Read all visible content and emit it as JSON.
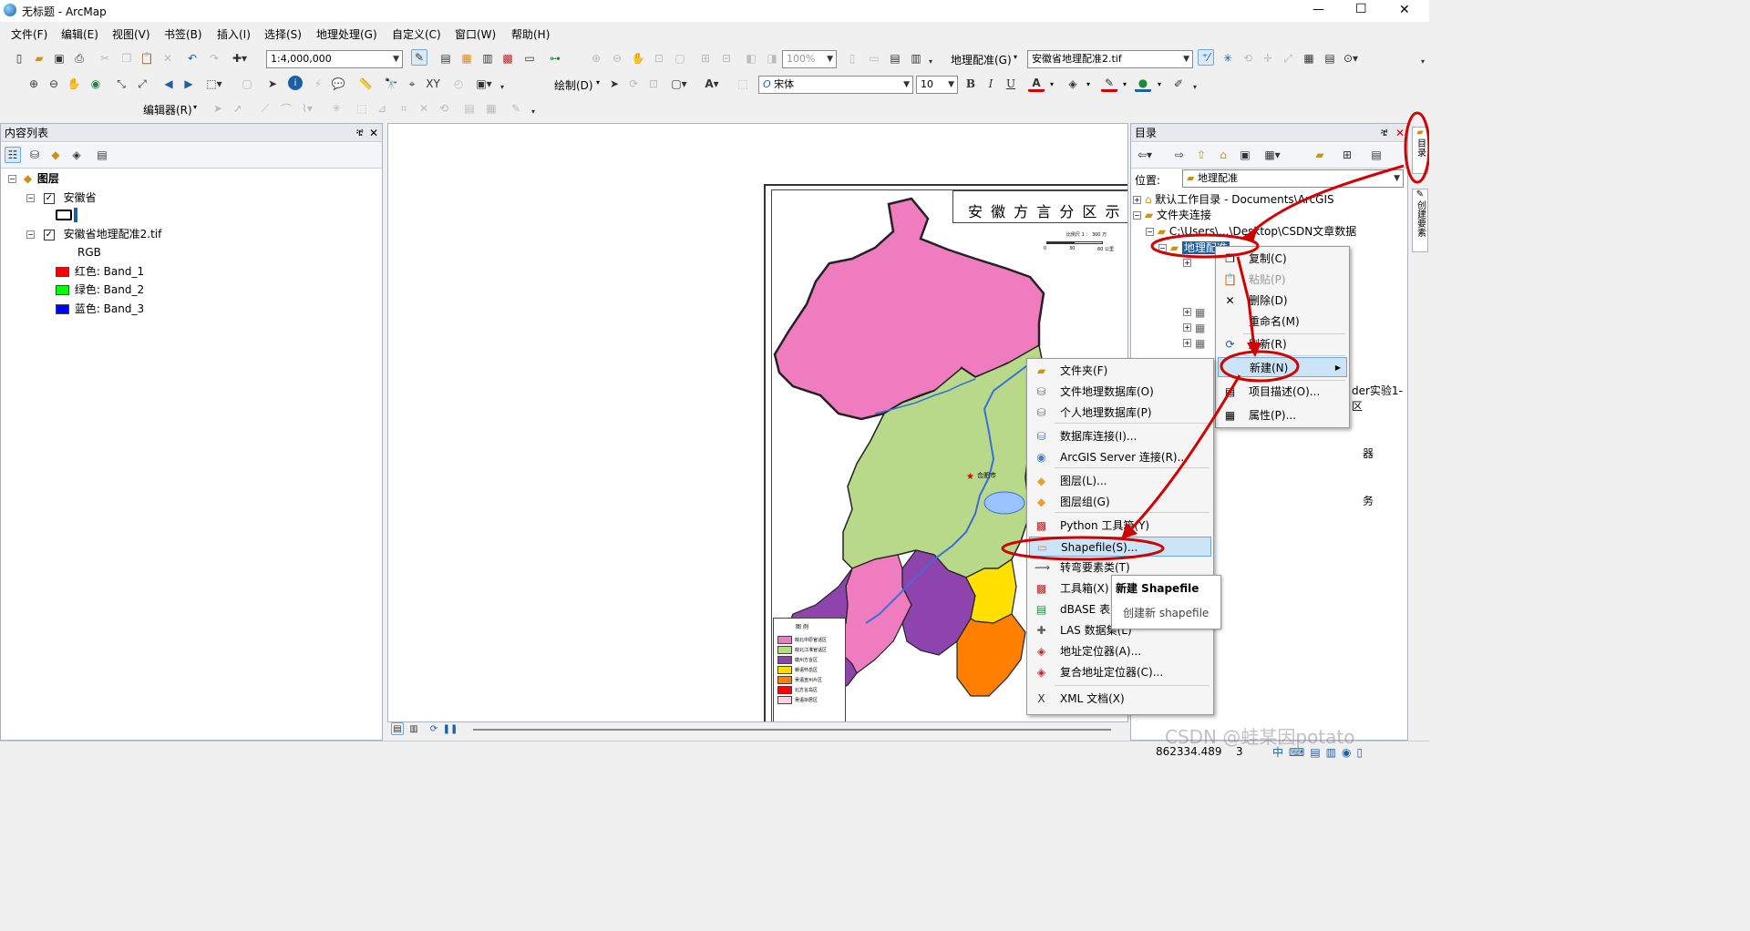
{
  "window": {
    "title": "无标题 - ArcMap",
    "controls": [
      "—",
      "☐",
      "✕"
    ]
  },
  "menubar": [
    "文件(F)",
    "编辑(E)",
    "视图(V)",
    "书签(B)",
    "插入(I)",
    "选择(S)",
    "地理处理(G)",
    "自定义(C)",
    "窗口(W)",
    "帮助(H)"
  ],
  "toolbar": {
    "scale": "1:4,000,000",
    "zoom": "100%",
    "georef_label": "地理配准(G)",
    "georef_layer": "安徽省地理配准2.tif",
    "draw_label": "绘制(D)",
    "font_name": "宋体",
    "font_size": "10",
    "bold": "B",
    "italic": "I",
    "underline": "U",
    "editor_label": "编辑器(R)"
  },
  "toc": {
    "title": "内容列表",
    "pin": "ቼ",
    "close": "✕",
    "layers_label": "图层",
    "layer1": "安徽省",
    "layer2": "安徽省地理配准2.tif",
    "rgb": "RGB",
    "bands": [
      {
        "label": "红色:   Band_1",
        "color": "#ff0000"
      },
      {
        "label": "绿色: Band_2",
        "color": "#00ff00"
      },
      {
        "label": "蓝色:   Band_3",
        "color": "#0000ff"
      }
    ]
  },
  "map": {
    "title": "安 徽 方 言 分 区 示 意",
    "scale_text": "比例尺 1 ： 300 万",
    "scale_ticks": [
      "0",
      "30",
      "60 公里"
    ],
    "legend_title": "图    例",
    "legend_items": [
      {
        "label": "皖北中原官话区",
        "color": "#f07cc0"
      },
      {
        "label": "皖北江淮官话区",
        "color": "#b8d88a"
      },
      {
        "label": "徽州方言区",
        "color": "#8e44ad"
      },
      {
        "label": "赣语怀岳区",
        "color": "#ffe000"
      },
      {
        "label": "吴语宣州片区",
        "color": "#ff8000"
      },
      {
        "label": "北方言岛区",
        "color": "#ff0000"
      },
      {
        "label": "吴语杂居区",
        "color": "#ffd0e0"
      }
    ],
    "capital": "合肥市"
  },
  "catalog": {
    "title": "目录",
    "location_label": "位置:",
    "location_value": "地理配准",
    "tree": [
      "默认工作目录 - Documents\\ArcGIS",
      "文件夹连接",
      "C:\\Users\\...\\Desktop\\CSDN文章数据",
      "地理配准"
    ],
    "partial_texts": [
      "der实验1-区",
      "器",
      "务"
    ]
  },
  "context_menu": {
    "items": [
      "复制(C)",
      "粘贴(P)",
      "删除(D)",
      "重命名(M)",
      "刷新(R)",
      "新建(N)",
      "项目描述(O)...",
      "属性(P)..."
    ]
  },
  "submenu": {
    "items": [
      "文件夹(F)",
      "文件地理数据库(O)",
      "个人地理数据库(P)",
      "数据库连接(I)...",
      "ArcGIS Server 连接(R)...",
      "图层(L)...",
      "图层组(G)",
      "Python 工具箱(Y)",
      "Shapefile(S)...",
      "转弯要素类(T)",
      "工具箱(X)",
      "dBASE 表(D)",
      "LAS 数据集(L)",
      "地址定位器(A)...",
      "复合地址定位器(C)...",
      "XML 文档(X)"
    ]
  },
  "tooltip": {
    "title": "新建 Shapefile",
    "body": "创建新 shapefile"
  },
  "side_tabs": [
    "目录",
    "创建要素"
  ],
  "statusbar": {
    "coords": "862334.489",
    "coords2": "3",
    "watermark": "CSDN @蛙某因potato"
  },
  "colors": {
    "highlight": "#cce4f7",
    "annotation": "#d10000",
    "panel": "#f0f0f0"
  }
}
